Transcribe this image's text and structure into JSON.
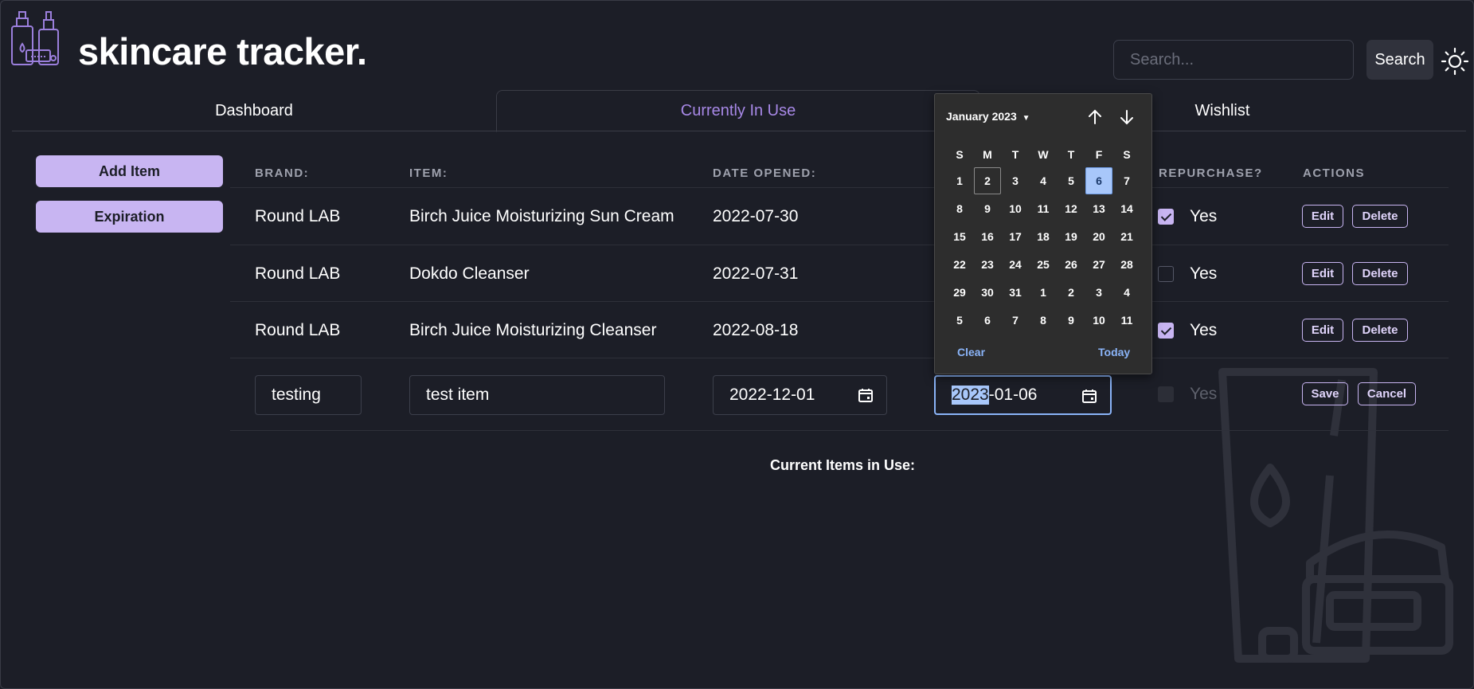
{
  "header": {
    "title": "skincare tracker.",
    "search_placeholder": "Search...",
    "search_button": "Search"
  },
  "tabs": [
    {
      "label": "Dashboard",
      "active": false
    },
    {
      "label": "Currently In Use",
      "active": true
    },
    {
      "label": "Wishlist",
      "active": false
    }
  ],
  "sidebar": {
    "add_item": "Add Item",
    "expiration": "Expiration"
  },
  "table": {
    "headers": {
      "brand": "BRAND:",
      "item": "ITEM:",
      "date_opened": "DATE OPENED:",
      "repurchase": "REPURCHASE?",
      "actions": "ACTIONS"
    },
    "rows": [
      {
        "brand": "Round LAB",
        "item": "Birch Juice Moisturizing Sun Cream",
        "date_opened": "2022-07-30",
        "repurchase": true,
        "repurchase_label": "Yes"
      },
      {
        "brand": "Round LAB",
        "item": "Dokdo Cleanser",
        "date_opened": "2022-07-31",
        "repurchase": false,
        "repurchase_label": "Yes"
      },
      {
        "brand": "Round LAB",
        "item": "Birch Juice Moisturizing Cleanser",
        "date_opened": "2022-08-18",
        "repurchase": true,
        "repurchase_label": "Yes"
      }
    ],
    "edit_label": "Edit",
    "delete_label": "Delete",
    "edit_row": {
      "brand": "testing",
      "item": "test item",
      "date_opened": "2022-12-01",
      "expiry_year": "2023",
      "expiry_rest": "-01-06",
      "repurchase_label": "Yes",
      "save": "Save",
      "cancel": "Cancel"
    }
  },
  "footer_label": "Current Items in Use:",
  "date_picker": {
    "month_label": "January 2023",
    "weekdays": [
      "S",
      "M",
      "T",
      "W",
      "T",
      "F",
      "S"
    ],
    "weeks": [
      [
        "1",
        "2",
        "3",
        "4",
        "5",
        "6",
        "7"
      ],
      [
        "8",
        "9",
        "10",
        "11",
        "12",
        "13",
        "14"
      ],
      [
        "15",
        "16",
        "17",
        "18",
        "19",
        "20",
        "21"
      ],
      [
        "22",
        "23",
        "24",
        "25",
        "26",
        "27",
        "28"
      ],
      [
        "29",
        "30",
        "31",
        "1",
        "2",
        "3",
        "4"
      ],
      [
        "5",
        "6",
        "7",
        "8",
        "9",
        "10",
        "11"
      ]
    ],
    "selected_day": "6",
    "outlined_day": "2",
    "clear": "Clear",
    "today": "Today"
  },
  "colors": {
    "background": "#1c1e27",
    "accent": "#c8b5f2",
    "active_tab": "#a788e6",
    "picker_link": "#8ab4f8"
  }
}
